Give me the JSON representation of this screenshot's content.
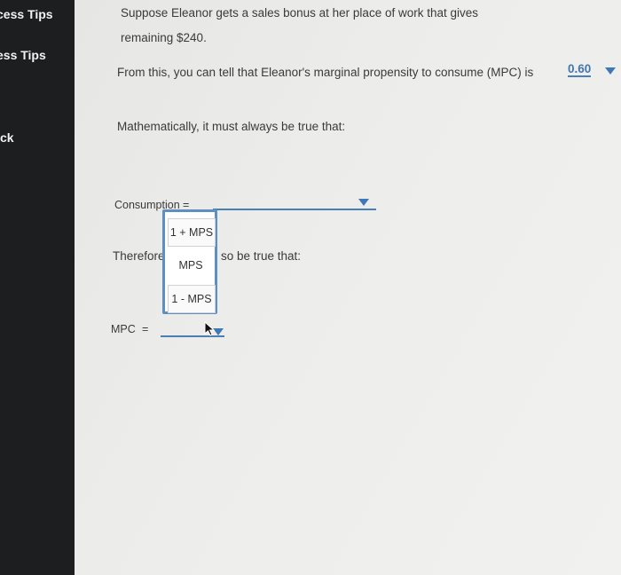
{
  "sidebar": {
    "items": [
      {
        "label": "cess Tips"
      },
      {
        "label": "ess Tips"
      },
      {
        "label": "ck"
      }
    ]
  },
  "question": {
    "line1": "Suppose Eleanor gets a sales bonus at her place of work that gives",
    "line2": "remaining $240.",
    "mpc_prefix": "From this, you can tell that Eleanor's marginal propensity to consume (MPC) is",
    "mpc_value": "0.60",
    "math_line": "Mathematically, it must always be true that:",
    "consumption_label": "Consumption",
    "equals": "=",
    "therefore_left": "Therefore",
    "therefore_right": "so be true that:",
    "mpc_label": "MPC",
    "mpc_equals": "="
  },
  "dropdown": {
    "options": [
      "1 + MPS",
      "MPS",
      "1 - MPS"
    ]
  },
  "colors": {
    "accent": "#4a7fb3",
    "sidebar_bg": "#1d1e20"
  }
}
